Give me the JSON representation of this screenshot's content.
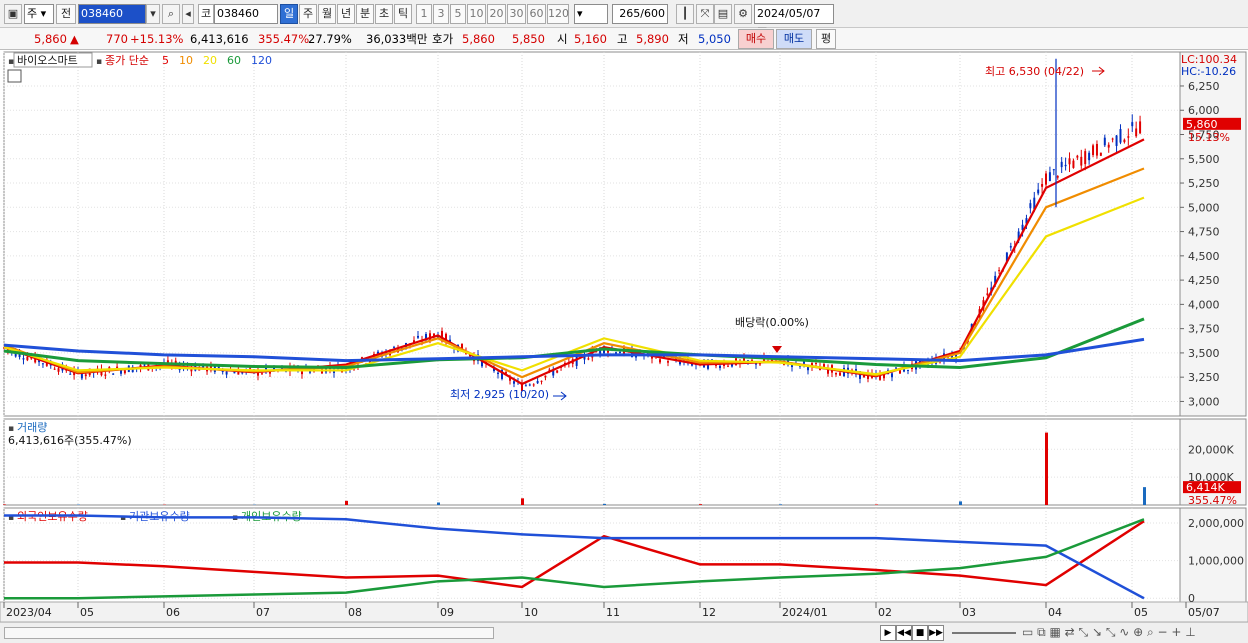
{
  "toolbar": {
    "period_type": "주",
    "prev_label": "전",
    "code": "038460",
    "name": "바이오스마",
    "market_badge": "코",
    "periods": [
      "일",
      "주",
      "월",
      "년",
      "분",
      "초",
      "틱"
    ],
    "selected_period": "일",
    "intervals": [
      "1",
      "3",
      "5",
      "10",
      "20",
      "30",
      "60",
      "120"
    ],
    "count": "265",
    "count_max": "/600",
    "date": "2024/05/07"
  },
  "quote": {
    "price": "5,860",
    "up_arrow": "▲",
    "change": "770",
    "change_pct": "+15.13%",
    "volume": "6,413,616",
    "vol_ratio": "355.47%",
    "turnover": "27.79%",
    "amount": "36,033백만",
    "hoga_label": "호가",
    "ask": "5,860",
    "bid": "5,850",
    "open_label": "시",
    "open": "5,160",
    "high_label": "고",
    "high": "5,890",
    "low_label": "저",
    "low": "5,050",
    "buy_label": "매수",
    "sell_label": "매도",
    "eval_label": "평"
  },
  "price_panel": {
    "stock_name": "바이오스마트",
    "ma_title": "종가 단순",
    "ma_periods": [
      {
        "label": "5",
        "color": "#e00000"
      },
      {
        "label": "10",
        "color": "#f08c00"
      },
      {
        "label": "20",
        "color": "#f0e000"
      },
      {
        "label": "60",
        "color": "#1a9a3a"
      },
      {
        "label": "120",
        "color": "#2050d8"
      }
    ],
    "lc": "LC:100.34",
    "hc": "HC:-10.26",
    "cur_price": "5,860",
    "cur_pct": "15.13%",
    "high_note": "최고 6,530 (04/22)",
    "low_note": "최저 2,925 (10/20)",
    "div_note": "배당락(0.00%)",
    "y_ticks": [
      "6,250",
      "6,000",
      "5,750",
      "5,500",
      "5,250",
      "5,000",
      "4,750",
      "4,500",
      "4,250",
      "4,000",
      "3,750",
      "3,500",
      "3,250",
      "3,000"
    ]
  },
  "volume_panel": {
    "title": "거래량",
    "subtitle": "6,413,616주(355.47%)",
    "y_ticks": [
      "20,000K",
      "10,000K"
    ],
    "cur": "6,414K",
    "cur_pct": "355.47%"
  },
  "holder_panel": {
    "legend": [
      {
        "label": "외국인보유수량",
        "color": "#e00000"
      },
      {
        "label": "기관보유수량",
        "color": "#2050d8"
      },
      {
        "label": "개인보유수량",
        "color": "#1a9a3a"
      }
    ],
    "y_ticks": [
      "2,000,000",
      "1,000,000",
      "0"
    ]
  },
  "x_axis": {
    "labels": [
      "2023/04",
      "05",
      "06",
      "07",
      "08",
      "09",
      "10",
      "11",
      "12",
      "2024/01",
      "02",
      "03",
      "04",
      "05",
      "05/07"
    ]
  },
  "chart_data": {
    "type": "line",
    "title": "바이오스마트",
    "x": [
      "2023/04",
      "05",
      "06",
      "07",
      "08",
      "09",
      "10",
      "11",
      "12",
      "2024/01",
      "02",
      "03",
      "04",
      "05"
    ],
    "series": [
      {
        "name": "종가",
        "values": [
          3550,
          3280,
          3380,
          3300,
          3350,
          3700,
          3150,
          3550,
          3380,
          3420,
          3250,
          3500,
          5300,
          5860
        ]
      },
      {
        "name": "5",
        "values": [
          3560,
          3290,
          3370,
          3300,
          3380,
          3680,
          3180,
          3560,
          3380,
          3410,
          3260,
          3520,
          5200,
          5700
        ]
      },
      {
        "name": "10",
        "values": [
          3580,
          3300,
          3360,
          3310,
          3360,
          3650,
          3250,
          3600,
          3400,
          3410,
          3270,
          3500,
          5000,
          5400
        ]
      },
      {
        "name": "20",
        "values": [
          3560,
          3320,
          3350,
          3320,
          3320,
          3600,
          3320,
          3650,
          3420,
          3400,
          3280,
          3460,
          4700,
          5100
        ]
      },
      {
        "name": "60",
        "values": [
          3520,
          3420,
          3390,
          3360,
          3350,
          3430,
          3450,
          3540,
          3480,
          3440,
          3380,
          3350,
          3450,
          3850
        ]
      },
      {
        "name": "120",
        "values": [
          3580,
          3520,
          3480,
          3460,
          3420,
          3440,
          3460,
          3480,
          3480,
          3460,
          3440,
          3420,
          3480,
          3640
        ]
      }
    ],
    "ylim": [
      2850,
      6600
    ],
    "high": {
      "value": 6530,
      "date": "04/22"
    },
    "low": {
      "value": 2925,
      "date": "10/20"
    },
    "volume": {
      "unit": "K",
      "values": [
        200,
        150,
        120,
        120,
        1500,
        900,
        2400,
        400,
        300,
        250,
        200,
        1300,
        26000,
        6414
      ],
      "ylim": [
        0,
        28000
      ]
    },
    "holders": {
      "ylim": [
        -100000,
        2400000
      ],
      "foreign": [
        950000,
        950000,
        850000,
        700000,
        550000,
        600000,
        300000,
        1650000,
        900000,
        900000,
        750000,
        600000,
        350000,
        2050000
      ],
      "institution": [
        2200000,
        2200000,
        2150000,
        2150000,
        2100000,
        1850000,
        1700000,
        1600000,
        1600000,
        1600000,
        1600000,
        1500000,
        1400000,
        0
      ],
      "individual": [
        0,
        0,
        50000,
        100000,
        150000,
        450000,
        550000,
        300000,
        450000,
        550000,
        650000,
        800000,
        1100000,
        2100000
      ]
    }
  }
}
